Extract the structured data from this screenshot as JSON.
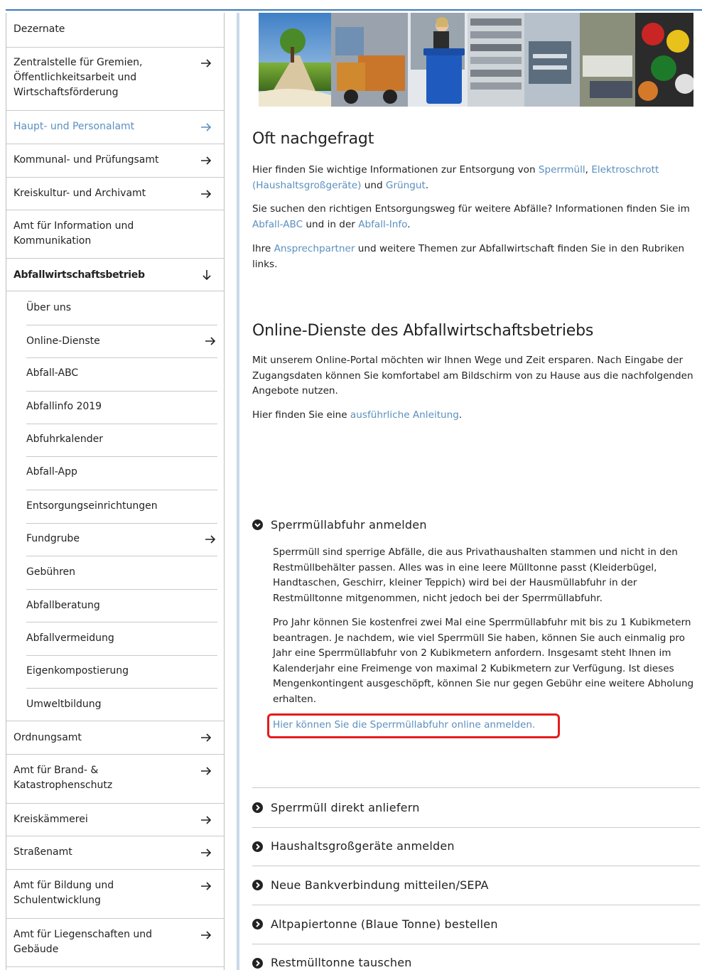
{
  "sidebar": {
    "items": [
      {
        "label": "Dezernate"
      },
      {
        "label": "Zentralstelle für Gremien, Öffentlichkeitsarbeit und Wirtschaftsförderung"
      },
      {
        "label": "Haupt- und Personalamt"
      },
      {
        "label": "Kommunal- und Prüfungsamt"
      },
      {
        "label": "Kreiskultur- und Archivamt"
      },
      {
        "label": "Amt für Information und Kommunikation"
      },
      {
        "label": "Abfallwirtschaftsbetrieb"
      },
      {
        "label": "Über uns"
      },
      {
        "label": "Online-Dienste"
      },
      {
        "label": "Abfall-ABC"
      },
      {
        "label": "Abfallinfo 2019"
      },
      {
        "label": "Abfuhrkalender"
      },
      {
        "label": "Abfall-App"
      },
      {
        "label": "Entsorgungseinrichtungen"
      },
      {
        "label": "Fundgrube"
      },
      {
        "label": "Gebühren"
      },
      {
        "label": "Abfallberatung"
      },
      {
        "label": "Abfallvermeidung"
      },
      {
        "label": "Eigenkompostierung"
      },
      {
        "label": "Umweltbildung"
      },
      {
        "label": "Ordnungsamt"
      },
      {
        "label": "Amt für Brand- & Katastrophenschutz"
      },
      {
        "label": "Kreiskämmerei"
      },
      {
        "label": "Straßenamt"
      },
      {
        "label": "Amt für Bildung und Schulentwicklung"
      },
      {
        "label": "Amt für Liegenschaften und Gebäude"
      }
    ]
  },
  "faq": {
    "title": "Oft nachgefragt",
    "p1": {
      "a": "Hier finden Sie wichtige Informationen zur Entsorgung von ",
      "l1": "Sperrmüll",
      "b": ", ",
      "l2": "Elektroschrott (Haushaltsgroßgeräte)",
      "c": " und ",
      "l3": "Grüngut",
      "d": "."
    },
    "p2": {
      "a": "Sie suchen den richtigen Entsorgungsweg für weitere Abfälle? Informationen finden Sie im ",
      "l1": "Abfall-ABC",
      "b": " und in der ",
      "l2": "Abfall-Info",
      "c": "."
    },
    "p3": {
      "a": "Ihre ",
      "l1": "Ansprechpartner",
      "b": " und weitere Themen zur Abfallwirtschaft finden Sie in den Rubriken links."
    }
  },
  "online": {
    "title": "Online-Dienste des Abfallwirtschaftsbetriebs",
    "p1": "Mit unserem Online-Portal möchten wir Ihnen Wege und Zeit ersparen. Nach Eingabe der Zugangsdaten können Sie komfortabel am Bildschirm von zu Hause aus die nachfolgenden Angebote nutzen.",
    "p2": {
      "a": "Hier finden Sie eine ",
      "l1": "ausführliche Anleitung",
      "b": "."
    }
  },
  "accordion": {
    "open": {
      "title": "Sperrmüllabfuhr anmelden",
      "p1": "Sperrmüll sind sperrige Abfälle, die aus Privathaushalten stammen und nicht in den Restmüllbehälter passen. Alles was in eine leere Mülltonne passt (Kleiderbügel, Handtaschen, Geschirr, kleiner Teppich) wird bei der Hausmüllabfuhr in der Restmülltonne mitgenommen, nicht jedoch bei der Sperrmüllabfuhr.",
      "p2": "Pro Jahr können Sie kostenfrei zwei Mal eine Sperrmüllabfuhr mit bis zu 1 Kubikmetern beantragen. Je nachdem, wie viel Sperrmüll Sie haben, können Sie auch einmalig pro Jahr eine Sperrmüllabfuhr von 2 Kubikmetern anfordern. Insgesamt steht Ihnen im Kalenderjahr eine Freimenge von maximal 2 Kubikmetern zur Verfügung.  Ist dieses Mengenkontingent ausgeschöpft, können Sie nur gegen Gebühr eine weitere Abholung erhalten.",
      "link": "Hier können Sie die Sperrmüllabfuhr online anmelden."
    },
    "closed": [
      {
        "title": "Sperrmüll direkt anliefern"
      },
      {
        "title": "Haushaltsgroßgeräte anmelden"
      },
      {
        "title": "Neue Bankverbindung mitteilen/SEPA"
      },
      {
        "title": "Altpapiertonne (Blaue Tonne) bestellen"
      },
      {
        "title": "Restmülltonne tauschen"
      }
    ]
  },
  "colors": {
    "link": "#5b8fbf",
    "highlight": "#e51c1c",
    "accent_rule": "#3b79b8"
  }
}
